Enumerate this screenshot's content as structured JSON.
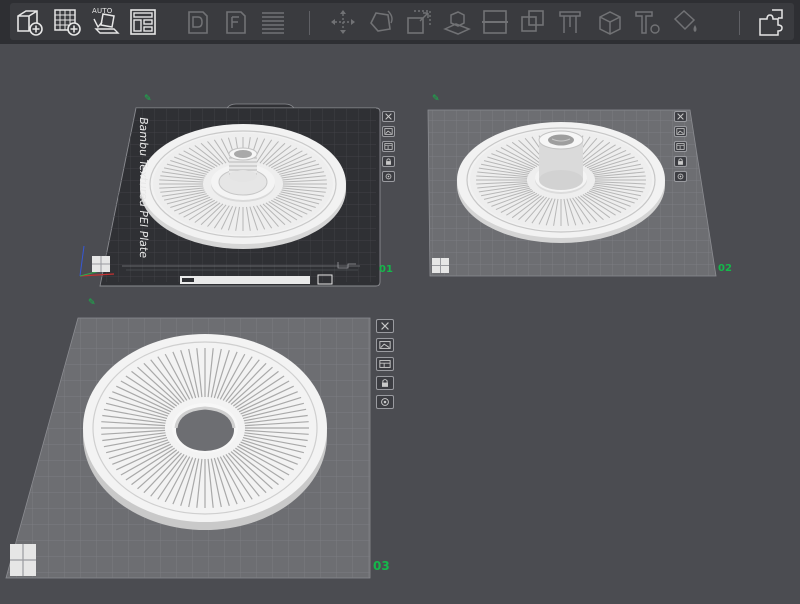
{
  "toolbar": {
    "buttons": [
      {
        "name": "add-object-icon",
        "state": "active"
      },
      {
        "name": "add-plate-icon",
        "state": "active"
      },
      {
        "name": "auto-orient-icon",
        "state": "active",
        "label": "AUTO"
      },
      {
        "name": "arrange-icon",
        "state": "active"
      },
      {
        "name": "split-objects-icon",
        "state": "disabled"
      },
      {
        "name": "split-parts-icon",
        "state": "disabled"
      },
      {
        "name": "variable-layer-icon",
        "state": "disabled"
      },
      {
        "name": "move-icon",
        "state": "disabled"
      },
      {
        "name": "rotate-icon",
        "state": "disabled"
      },
      {
        "name": "scale-icon",
        "state": "disabled"
      },
      {
        "name": "lay-on-face-icon",
        "state": "disabled"
      },
      {
        "name": "cut-icon",
        "state": "disabled"
      },
      {
        "name": "boolean-icon",
        "state": "disabled"
      },
      {
        "name": "support-paint-icon",
        "state": "disabled"
      },
      {
        "name": "seam-paint-icon",
        "state": "disabled"
      },
      {
        "name": "text-icon",
        "state": "disabled"
      },
      {
        "name": "color-paint-icon",
        "state": "disabled"
      },
      {
        "name": "assembly-view-icon",
        "state": "active"
      }
    ]
  },
  "plates": [
    {
      "id": "plate-1",
      "number": "01",
      "bed_label": "Bambu Textured PEI Plate",
      "state": "selected",
      "part": "spool-with-threaded-hub"
    },
    {
      "id": "plate-2",
      "number": "02",
      "state": "normal",
      "part": "spool-with-tall-threaded-hub"
    },
    {
      "id": "plate-3",
      "number": "03",
      "state": "normal",
      "part": "ring-with-center-hole"
    }
  ],
  "plate_side_icons": [
    "close-icon",
    "picture-icon",
    "arrange-icon",
    "lock-icon",
    "settings-icon"
  ],
  "colors": {
    "background": "#4b4c51",
    "toolbar": "#2e2f33",
    "accent": "#14b84a",
    "bed_dark": "#2f3034",
    "bed_light": "#6d6e72",
    "part": "#ececec"
  }
}
